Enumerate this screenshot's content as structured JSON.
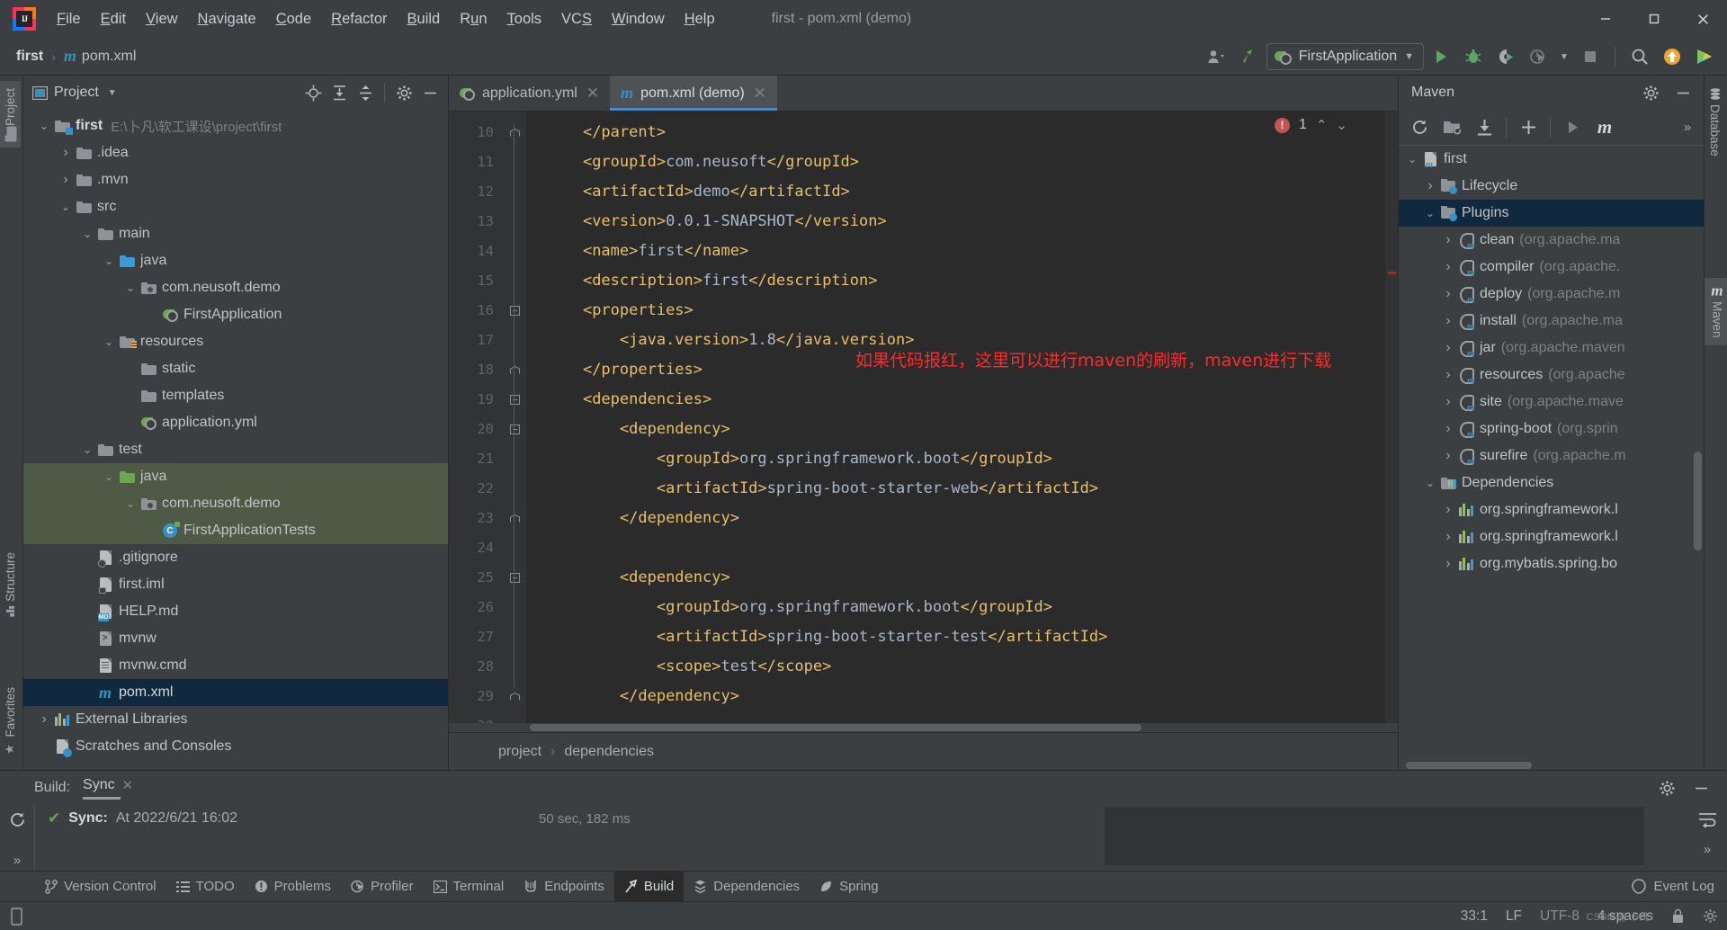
{
  "window": {
    "title": "first - pom.xml (demo)",
    "logo_text": "IJ",
    "controls": {
      "minimize": "—",
      "maximize": "□",
      "close": "✕"
    }
  },
  "menu": [
    {
      "label": "File",
      "accel": "F"
    },
    {
      "label": "Edit",
      "accel": "E"
    },
    {
      "label": "View",
      "accel": "V"
    },
    {
      "label": "Navigate",
      "accel": "N"
    },
    {
      "label": "Code",
      "accel": "C"
    },
    {
      "label": "Refactor",
      "accel": "R"
    },
    {
      "label": "Build",
      "accel": "B"
    },
    {
      "label": "Run",
      "accel": "u"
    },
    {
      "label": "Tools",
      "accel": "T"
    },
    {
      "label": "VCS",
      "accel": "S"
    },
    {
      "label": "Window",
      "accel": "W"
    },
    {
      "label": "Help",
      "accel": "H"
    }
  ],
  "navbar": {
    "crumbs": [
      "first",
      "pom.xml"
    ],
    "separator": "›",
    "run_config": "FirstApplication",
    "icons": [
      "user-dropdown-icon",
      "updates-hammer-icon",
      "run-icon",
      "debug-icon",
      "run-coverage-icon",
      "profiler-icon",
      "stop-icon",
      "search-everywhere-icon",
      "update-project-icon",
      "ide-features-icon"
    ]
  },
  "left_stripes": [
    {
      "label": "Project",
      "active": true
    },
    {
      "label": "Structure",
      "active": false
    },
    {
      "label": "Favorites",
      "active": false
    }
  ],
  "right_stripes": [
    {
      "label": "Database",
      "active": false
    },
    {
      "label": "Maven",
      "active": true
    }
  ],
  "project_panel": {
    "title": "Project",
    "actions": [
      "locate-icon",
      "expand-all-icon",
      "collapse-all-icon",
      "settings-gear-icon",
      "hide-panel-icon"
    ],
    "tree": [
      {
        "label": "first",
        "path": "E:\\卜凡\\软工课设\\project\\first",
        "indent": 0,
        "arrow": "v",
        "icon": "module-folder",
        "bold": true,
        "selected": "none"
      },
      {
        "label": ".idea",
        "path": "",
        "indent": 1,
        "arrow": ">",
        "icon": "folder",
        "bold": false,
        "selected": "none"
      },
      {
        "label": ".mvn",
        "path": "",
        "indent": 1,
        "arrow": ">",
        "icon": "folder",
        "bold": false,
        "selected": "none"
      },
      {
        "label": "src",
        "path": "",
        "indent": 1,
        "arrow": "v",
        "icon": "folder",
        "bold": false,
        "selected": "none"
      },
      {
        "label": "main",
        "path": "",
        "indent": 2,
        "arrow": "v",
        "icon": "folder",
        "bold": false,
        "selected": "none"
      },
      {
        "label": "java",
        "path": "",
        "indent": 3,
        "arrow": "v",
        "icon": "folder-blue",
        "bold": false,
        "selected": "none"
      },
      {
        "label": "com.neusoft.demo",
        "path": "",
        "indent": 4,
        "arrow": "v",
        "icon": "package",
        "bold": false,
        "selected": "none"
      },
      {
        "label": "FirstApplication",
        "path": "",
        "indent": 5,
        "arrow": "",
        "icon": "spring-boot-class",
        "bold": false,
        "selected": "none"
      },
      {
        "label": "resources",
        "path": "",
        "indent": 3,
        "arrow": "v",
        "icon": "folder-resources",
        "bold": false,
        "selected": "none"
      },
      {
        "label": "static",
        "path": "",
        "indent": 4,
        "arrow": "",
        "icon": "folder",
        "bold": false,
        "selected": "none"
      },
      {
        "label": "templates",
        "path": "",
        "indent": 4,
        "arrow": "",
        "icon": "folder",
        "bold": false,
        "selected": "none"
      },
      {
        "label": "application.yml",
        "path": "",
        "indent": 4,
        "arrow": "",
        "icon": "spring-yml",
        "bold": false,
        "selected": "none"
      },
      {
        "label": "test",
        "path": "",
        "indent": 2,
        "arrow": "v",
        "icon": "folder",
        "bold": false,
        "selected": "none"
      },
      {
        "label": "java",
        "path": "",
        "indent": 3,
        "arrow": "v",
        "icon": "folder-green",
        "bold": false,
        "selected": "green"
      },
      {
        "label": "com.neusoft.demo",
        "path": "",
        "indent": 4,
        "arrow": "v",
        "icon": "package",
        "bold": false,
        "selected": "green"
      },
      {
        "label": "FirstApplicationTests",
        "path": "",
        "indent": 5,
        "arrow": "",
        "icon": "test-class",
        "bold": false,
        "selected": "green"
      },
      {
        "label": ".gitignore",
        "path": "",
        "indent": 2,
        "arrow": "",
        "icon": "file-ignored",
        "bold": false,
        "selected": "none"
      },
      {
        "label": "first.iml",
        "path": "",
        "indent": 2,
        "arrow": "",
        "icon": "file-iml",
        "bold": false,
        "selected": "none"
      },
      {
        "label": "HELP.md",
        "path": "",
        "indent": 2,
        "arrow": "",
        "icon": "file-md",
        "bold": false,
        "selected": "none"
      },
      {
        "label": "mvnw",
        "path": "",
        "indent": 2,
        "arrow": "",
        "icon": "file-script",
        "bold": false,
        "selected": "none"
      },
      {
        "label": "mvnw.cmd",
        "path": "",
        "indent": 2,
        "arrow": "",
        "icon": "file-cmd",
        "bold": false,
        "selected": "none"
      },
      {
        "label": "pom.xml",
        "path": "",
        "indent": 2,
        "arrow": "",
        "icon": "maven-file",
        "bold": false,
        "selected": "blue"
      },
      {
        "label": "External Libraries",
        "path": "",
        "indent": 0,
        "arrow": ">",
        "icon": "libraries",
        "bold": false,
        "selected": "none"
      },
      {
        "label": "Scratches and Consoles",
        "path": "",
        "indent": 0,
        "arrow": "",
        "icon": "scratches",
        "bold": false,
        "selected": "none"
      }
    ]
  },
  "editor": {
    "tabs": [
      {
        "label": "application.yml",
        "icon": "spring-yml-icon",
        "active": false
      },
      {
        "label": "pom.xml (demo)",
        "icon": "maven-icon",
        "active": true
      }
    ],
    "first_line": 10,
    "lines": [
      {
        "n": 10,
        "fold": "end",
        "text": "    </parent>"
      },
      {
        "n": 11,
        "fold": "",
        "text": "    <groupId>com.neusoft</groupId>"
      },
      {
        "n": 12,
        "fold": "",
        "text": "    <artifactId>demo</artifactId>"
      },
      {
        "n": 13,
        "fold": "",
        "text": "    <version>0.0.1-SNAPSHOT</version>"
      },
      {
        "n": 14,
        "fold": "",
        "text": "    <name>first</name>"
      },
      {
        "n": 15,
        "fold": "",
        "text": "    <description>first</description>"
      },
      {
        "n": 16,
        "fold": "start",
        "text": "    <properties>"
      },
      {
        "n": 17,
        "fold": "",
        "text": "        <java.version>1.8</java.version>"
      },
      {
        "n": 18,
        "fold": "end",
        "text": "    </properties>"
      },
      {
        "n": 19,
        "fold": "start",
        "text": "    <dependencies>"
      },
      {
        "n": 20,
        "fold": "start",
        "text": "        <dependency>"
      },
      {
        "n": 21,
        "fold": "",
        "text": "            <groupId>org.springframework.boot</groupId>"
      },
      {
        "n": 22,
        "fold": "",
        "text": "            <artifactId>spring-boot-starter-web</artifactId>"
      },
      {
        "n": 23,
        "fold": "end",
        "text": "        </dependency>"
      },
      {
        "n": 24,
        "fold": "",
        "text": ""
      },
      {
        "n": 25,
        "fold": "start",
        "text": "        <dependency>"
      },
      {
        "n": 26,
        "fold": "",
        "text": "            <groupId>org.springframework.boot</groupId>"
      },
      {
        "n": 27,
        "fold": "",
        "text": "            <artifactId>spring-boot-starter-test</artifactId>"
      },
      {
        "n": 28,
        "fold": "",
        "text": "            <scope>test</scope>"
      },
      {
        "n": 29,
        "fold": "end",
        "text": "        </dependency>"
      },
      {
        "n": 30,
        "fold": "",
        "text": ""
      }
    ],
    "inspection": {
      "error_count": "1",
      "badge": "!",
      "up": "⌃",
      "down": "⌄"
    },
    "breadcrumbs": [
      "project",
      "dependencies"
    ],
    "breadcrumb_sep": "›",
    "annotation": {
      "text": "如果代码报红，这里可以进行maven的刷新，maven进行下载",
      "color": "#ff2a2a",
      "arrow": "red-arrow-annotation"
    },
    "refresh_popup": {
      "icon": "maven-reload-icon",
      "close": "✕"
    }
  },
  "maven_panel": {
    "title": "Maven",
    "head_actions": [
      "settings-gear-icon",
      "hide-panel-icon"
    ],
    "toolbar": [
      "reload-all-icon",
      "add-maven-project-icon",
      "download-sources-icon",
      "add-icon",
      "run-icon",
      "execute-goal-icon",
      "more-icon"
    ],
    "tree": [
      {
        "label": "first",
        "sub": "",
        "indent": 0,
        "arrow": "v",
        "icon": "maven-project",
        "selected": false
      },
      {
        "label": "Lifecycle",
        "sub": "",
        "indent": 1,
        "arrow": ">",
        "icon": "phase-group",
        "selected": false
      },
      {
        "label": "Plugins",
        "sub": "",
        "indent": 1,
        "arrow": "v",
        "icon": "phase-group",
        "selected": true
      },
      {
        "label": "clean",
        "sub": "(org.apache.ma",
        "indent": 2,
        "arrow": ">",
        "icon": "plugin",
        "selected": false
      },
      {
        "label": "compiler",
        "sub": "(org.apache.",
        "indent": 2,
        "arrow": ">",
        "icon": "plugin",
        "selected": false
      },
      {
        "label": "deploy",
        "sub": "(org.apache.m",
        "indent": 2,
        "arrow": ">",
        "icon": "plugin",
        "selected": false
      },
      {
        "label": "install",
        "sub": "(org.apache.ma",
        "indent": 2,
        "arrow": ">",
        "icon": "plugin",
        "selected": false
      },
      {
        "label": "jar",
        "sub": "(org.apache.maven",
        "indent": 2,
        "arrow": ">",
        "icon": "plugin",
        "selected": false
      },
      {
        "label": "resources",
        "sub": "(org.apache",
        "indent": 2,
        "arrow": ">",
        "icon": "plugin",
        "selected": false
      },
      {
        "label": "site",
        "sub": "(org.apache.mave",
        "indent": 2,
        "arrow": ">",
        "icon": "plugin",
        "selected": false
      },
      {
        "label": "spring-boot",
        "sub": "(org.sprin",
        "indent": 2,
        "arrow": ">",
        "icon": "plugin",
        "selected": false
      },
      {
        "label": "surefire",
        "sub": "(org.apache.m",
        "indent": 2,
        "arrow": ">",
        "icon": "plugin",
        "selected": false
      },
      {
        "label": "Dependencies",
        "sub": "",
        "indent": 1,
        "arrow": "v",
        "icon": "dependencies-group",
        "selected": false
      },
      {
        "label": "org.springframework.l",
        "sub": "",
        "indent": 2,
        "arrow": ">",
        "icon": "library",
        "selected": false
      },
      {
        "label": "org.springframework.l",
        "sub": "",
        "indent": 2,
        "arrow": ">",
        "icon": "library",
        "selected": false
      },
      {
        "label": "org.mybatis.spring.bo",
        "sub": "",
        "indent": 2,
        "arrow": ">",
        "icon": "library",
        "selected": false
      }
    ]
  },
  "build_panel": {
    "label": "Build:",
    "tab": "Sync",
    "tab_close": "✕",
    "actions": [
      "settings-gear-icon",
      "hide-panel-icon"
    ],
    "left_actions": [
      "rerun-icon",
      "expand-more-icon"
    ],
    "right_actions": [
      "soft-wrap-icon",
      "more-icon"
    ],
    "result": {
      "status_icon": "✔",
      "key": "Sync:",
      "value": "At 2022/6/21 16:02",
      "duration": "50 sec, 182 ms"
    }
  },
  "bottom_tools": [
    {
      "label": "Version Control",
      "icon": "branch-icon",
      "active": false
    },
    {
      "label": "TODO",
      "icon": "todo-list-icon",
      "active": false
    },
    {
      "label": "Problems",
      "icon": "problems-icon",
      "active": false
    },
    {
      "label": "Profiler",
      "icon": "profiler-icon",
      "active": false
    },
    {
      "label": "Terminal",
      "icon": "terminal-icon",
      "active": false
    },
    {
      "label": "Endpoints",
      "icon": "endpoints-icon",
      "active": false
    },
    {
      "label": "Build",
      "icon": "build-hammer-icon",
      "active": true
    },
    {
      "label": "Dependencies",
      "icon": "dependencies-icon",
      "active": false
    },
    {
      "label": "Spring",
      "icon": "spring-leaf-icon",
      "active": false
    }
  ],
  "event_log": {
    "label": "Event Log",
    "icon": "balloon-icon"
  },
  "statusbar": {
    "memory_icon": "memory-indicator-icon",
    "caret": "33:1",
    "line_separator": "LF",
    "encoding": "UTF-8",
    "indent": "4 spaces",
    "watermark": "CSDN @ 卜凡",
    "lock_icon": "read-only-lock-icon",
    "gear_icon": "settings-gear-icon"
  },
  "colors": {
    "bg_panel": "#3c3f41",
    "bg_editor": "#2b2b2b",
    "accent_blue": "#3592c4",
    "selection_blue": "#11293f",
    "selection_green": "#4e5a46",
    "tag_orange": "#e8bf6a",
    "value_grey": "#a9b7c6",
    "annotation_red": "#ff2a2a",
    "error_red": "#c75450",
    "spring_green": "#6aa84f"
  }
}
